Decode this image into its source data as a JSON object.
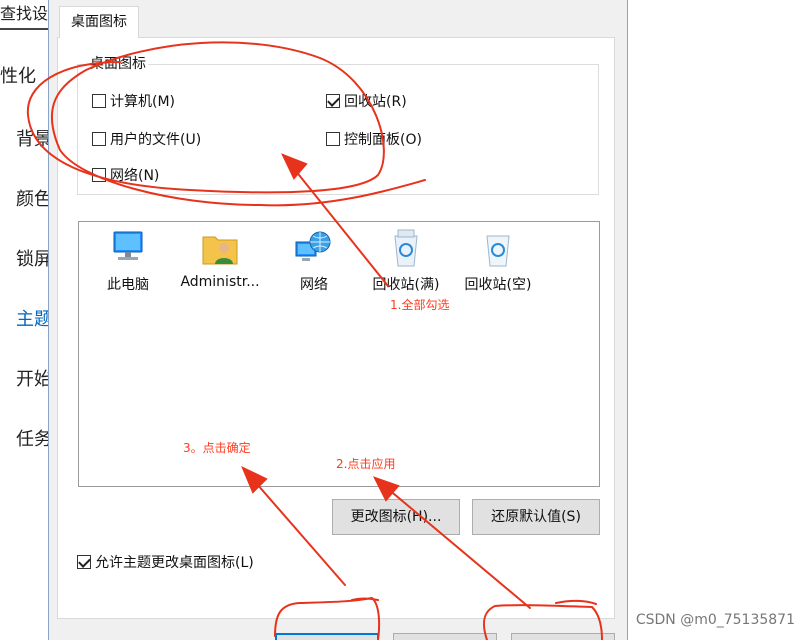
{
  "background_window": {
    "search_fragment": "查找设置",
    "section_fragment": "性化",
    "nav_items": [
      {
        "label": "背景",
        "active": false
      },
      {
        "label": "颜色",
        "active": false
      },
      {
        "label": "锁屏",
        "active": false
      },
      {
        "label": "主题",
        "active": true
      },
      {
        "label": "开始",
        "active": false
      },
      {
        "label": "任务",
        "active": false
      }
    ]
  },
  "dialog": {
    "tab_label": "桌面图标",
    "group_title": "桌面图标",
    "checkboxes": [
      {
        "label": "计算机(M)",
        "checked": false
      },
      {
        "label": "回收站(R)",
        "checked": true
      },
      {
        "label": "用户的文件(U)",
        "checked": false
      },
      {
        "label": "控制面板(O)",
        "checked": false
      },
      {
        "label": "网络(N)",
        "checked": false
      }
    ],
    "icons": [
      {
        "label": "此电脑",
        "icon": "computer-icon"
      },
      {
        "label": "Administr...",
        "icon": "user-folder-icon"
      },
      {
        "label": "网络",
        "icon": "network-icon"
      },
      {
        "label": "回收站(满)",
        "icon": "recycle-bin-full-icon"
      },
      {
        "label": "回收站(空)",
        "icon": "recycle-bin-empty-icon"
      }
    ],
    "change_icon_button": "更改图标(H)...",
    "restore_default_button": "还原默认值(S)",
    "allow_themes_checkbox": {
      "label": "允许主题更改桌面图标(L)",
      "checked": true
    }
  },
  "annotations": {
    "step1": "1.全部勾选",
    "step2": "2.点击应用",
    "step3": "3。点击确定",
    "color": "#ff3b1f"
  },
  "watermark": "CSDN @m0_75135871"
}
